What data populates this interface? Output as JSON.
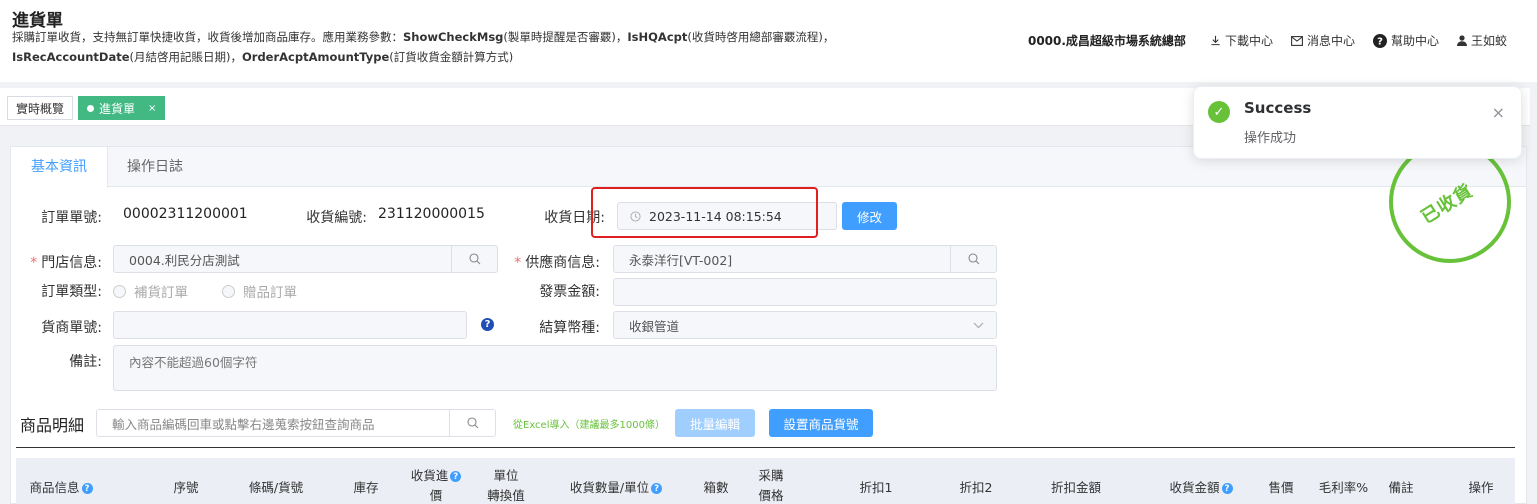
{
  "header": {
    "title": "進貨單",
    "desc_line1_prefix": "採購訂單收貨，支持無訂單快捷收貨，收貨後增加商品庫存。應用業務參數：",
    "desc_p1_key": "ShowCheckMsg",
    "desc_p1_text": "(製單時提醒是否審覈)，",
    "desc_p2_key": "IsHQAcpt",
    "desc_p2_text": "(收貨時啓用總部審覈流程)，",
    "desc_p3_key": "IsRecAccountDate",
    "desc_p3_text": "(月結啓用記賬日期)，",
    "desc_p4_key": "OrderAcptAmountType",
    "desc_p4_text": "(訂貨收貨金額計算方式)",
    "company": "0000.成昌超級市場系統總部",
    "download": "下載中心",
    "message": "消息中心",
    "help": "幫助中心",
    "user": "王如蛟"
  },
  "tabs": {
    "overview": "實時概覽",
    "current": "進貨單",
    "close": "×"
  },
  "card_tabs": {
    "basic": "基本資訊",
    "log": "操作日誌"
  },
  "form": {
    "order_no_label": "訂單單號:",
    "order_no_value": "00002311200001",
    "receipt_no_label": "收貨編號:",
    "receipt_no_value": "231120000015",
    "receipt_date_label": "收貨日期:",
    "receipt_date_value": "2023-11-14 08:15:54",
    "modify_button": "修改",
    "store_label": "門店信息:",
    "store_value": "0004.利民分店測試",
    "supplier_label": "供應商信息:",
    "supplier_value": "永泰洋行[VT-002]",
    "order_type_label": "訂單類型:",
    "order_type_opt1": "補貨訂單",
    "order_type_opt2": "贈品訂單",
    "invoice_label": "發票金額:",
    "invoice_value": "",
    "vendor_no_label": "貨商單號:",
    "vendor_no_value": "",
    "currency_label": "結算幣種:",
    "currency_value": "收銀管道",
    "remark_label": "備註:",
    "remark_placeholder": "內容不能超過60個字符"
  },
  "stamp": "已收貨",
  "products": {
    "title": "商品明細",
    "search_placeholder": "輸入商品編碼回車或點擊右邊蒐索按鈕查詢商品",
    "excel_import": "從Excel導入（建議最多1000條）",
    "batch_edit": "批量編輯",
    "set_number": "設置商品貨號"
  },
  "table": {
    "col_product": "商品信息",
    "col_seq": "序號",
    "col_barcode": "條碼/貨號",
    "col_stock": "庫存",
    "col_price_l1": "收貨進",
    "col_price_l2": "價",
    "col_unit_l1": "單位",
    "col_unit_l2": "轉換值",
    "col_qty": "收貨數量/單位",
    "col_boxes": "箱數",
    "col_purchase_l1": "采購",
    "col_purchase_l2": "價格",
    "col_disc1": "折扣1",
    "col_disc2": "折扣2",
    "col_disc_amt": "折扣金額",
    "col_amount": "收貨金額",
    "col_sale": "售價",
    "col_margin": "毛利率%",
    "col_remark": "備註",
    "col_action": "操作"
  },
  "toast": {
    "title": "Success",
    "message": "操作成功",
    "close": "×"
  },
  "colors": {
    "primary": "#409eff",
    "success": "#67c23a",
    "tab_active": "#42b983",
    "highlight": "#e02020"
  }
}
